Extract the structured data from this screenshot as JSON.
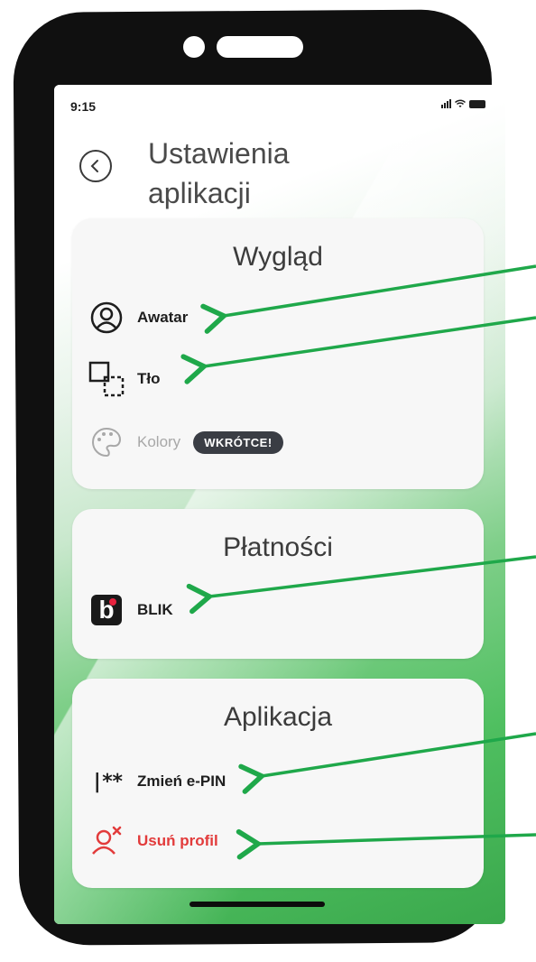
{
  "status_bar": {
    "time": "9:15"
  },
  "header": {
    "title_line1": "Ustawienia",
    "title_line2": "aplikacji",
    "back_icon": "chevron-left-icon"
  },
  "sections": {
    "wyglad": {
      "title": "Wygląd",
      "items": [
        {
          "label": "Awatar",
          "icon": "avatar-icon"
        },
        {
          "label": "Tło",
          "icon": "background-icon"
        },
        {
          "label": "Kolory",
          "icon": "palette-icon",
          "badge": "WKRÓTCE!"
        }
      ]
    },
    "platnosci": {
      "title": "Płatności",
      "items": [
        {
          "label": "BLIK",
          "icon": "blik-icon"
        }
      ]
    },
    "aplikacja": {
      "title": "Aplikacja",
      "items": [
        {
          "label": "Zmień e-PIN",
          "icon": "pin-icon",
          "icon_text": "|**"
        },
        {
          "label": "Usuń profil",
          "icon": "delete-profile-icon"
        }
      ]
    }
  },
  "colors": {
    "accent_green": "#2ea84a",
    "danger": "#e23b3b",
    "badge": "#3a3d44"
  }
}
